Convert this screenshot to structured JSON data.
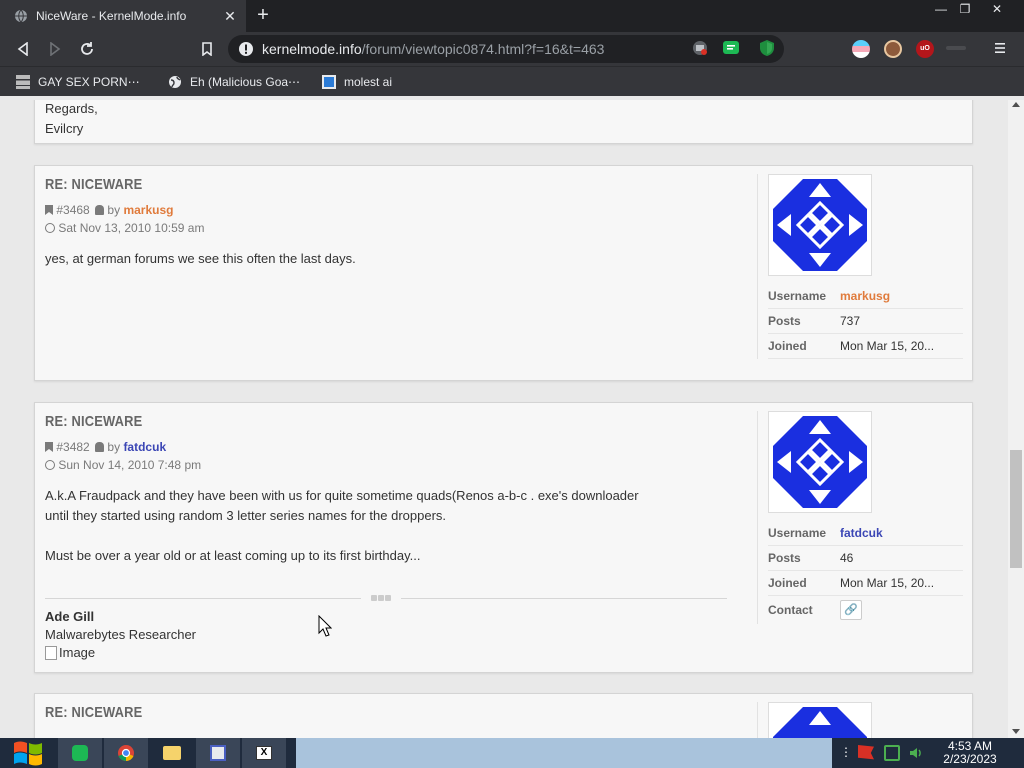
{
  "browser": {
    "tab_title": "NiceWare - KernelMode.info",
    "url_host": "kernelmode.info",
    "url_path": "/forum/viewtopic0874.html?f=16&t=463",
    "bookmarks": [
      {
        "label": "GAY SEX PORN⋯"
      },
      {
        "label": "Eh (Malicious Goa⋯"
      },
      {
        "label": "molest ai"
      }
    ]
  },
  "page": {
    "top_fragment": {
      "line1": "Regards,",
      "line2": "Evilcry"
    },
    "posts": [
      {
        "title": "RE: NICEWARE",
        "id": "#3468",
        "by": "by",
        "author": "markusg",
        "author_color": "#e07b3c",
        "date": "Sat Nov 13, 2010 10:59 am",
        "content": [
          "yes, at german forums we see this often the last days."
        ],
        "profile": {
          "username_label": "Username",
          "username": "markusg",
          "posts_label": "Posts",
          "posts": "737",
          "joined_label": "Joined",
          "joined": "Mon Mar 15, 20..."
        }
      },
      {
        "title": "RE: NICEWARE",
        "id": "#3482",
        "by": "by",
        "author": "fatdcuk",
        "author_color": "#3b46b5",
        "date": "Sun Nov 14, 2010 7:48 pm",
        "content": [
          "A.k.A Fraudpack and they have been with us for quite sometime quads(Renos a-b-c . exe's downloader",
          "until they started using random 3 letter series names for the droppers.",
          "",
          "Must be over a year old or at least coming up to its first birthday..."
        ],
        "signature": {
          "name": "Ade Gill",
          "role": "Malwarebytes Researcher",
          "image_alt": "Image"
        },
        "profile": {
          "username_label": "Username",
          "username": "fatdcuk",
          "posts_label": "Posts",
          "posts": "46",
          "joined_label": "Joined",
          "joined": "Mon Mar 15, 20...",
          "contact_label": "Contact"
        }
      },
      {
        "title": "RE: NICEWARE"
      }
    ]
  },
  "taskbar": {
    "time": "4:53 AM",
    "date": "2/23/2023"
  },
  "colors": {
    "avatar_blue": "#1a2fe0",
    "link_orange": "#e07b3c",
    "link_blue": "#3b46b5"
  }
}
